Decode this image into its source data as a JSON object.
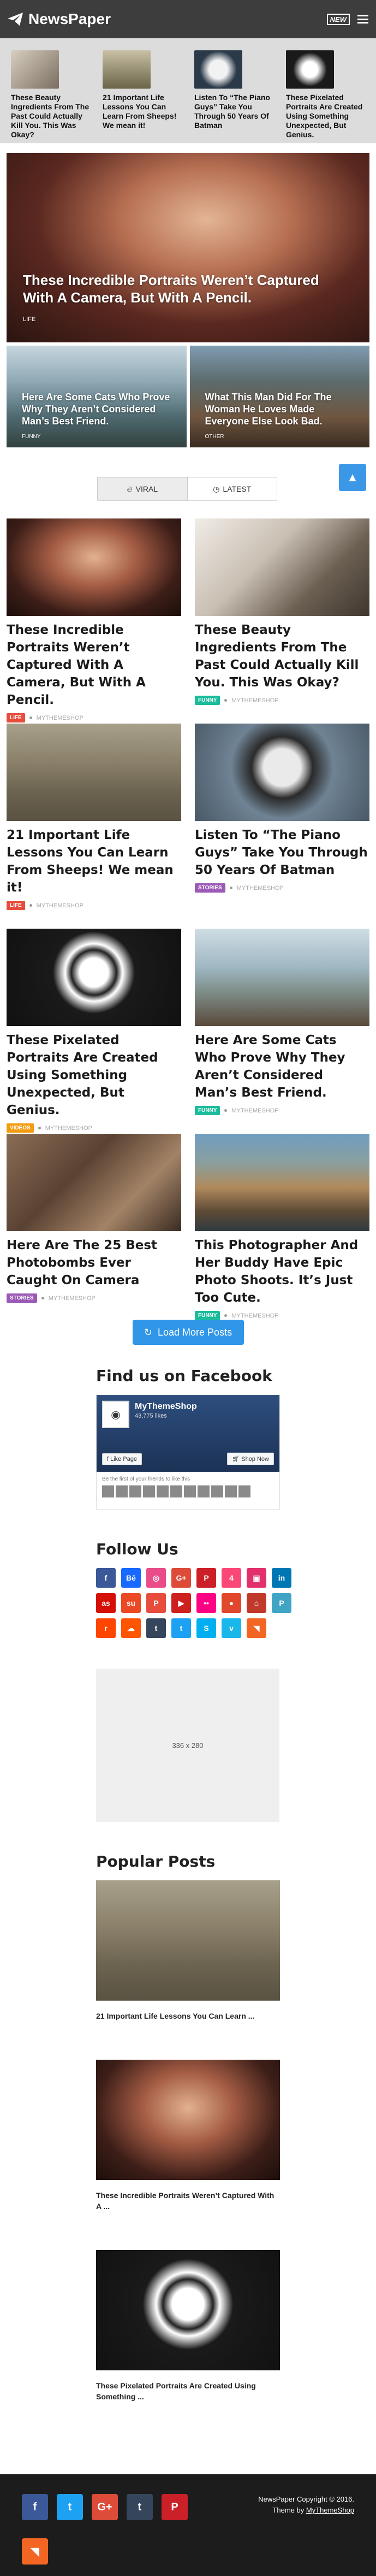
{
  "header": {
    "logo_text": "NewsPaper",
    "new_badge": "NEW"
  },
  "ticker": [
    {
      "title": "These Beauty Ingredients From The Past Could Actually Kill You. This Was Okay?",
      "thumb": "#8a7f74"
    },
    {
      "title": "21 Important Life Lessons You Can Learn From Sheeps! We mean it!",
      "thumb": "#9b9074"
    },
    {
      "title": "Listen To “The Piano Guys” Take You Through 50 Years Of Batman",
      "thumb": "#3a4a5a"
    },
    {
      "title": "These Pixelated Portraits Are Created Using Something Unexpected, But Genius.",
      "thumb": "#1f2d3a"
    }
  ],
  "featured": {
    "main": {
      "title": "These Incredible Portraits Weren’t Captured With A Camera, But With A Pencil.",
      "category": "LIFE"
    },
    "left": {
      "title": "Here Are Some Cats Who Prove Why They Aren’t Considered Man’s Best Friend.",
      "category": "FUNNY"
    },
    "right": {
      "title": "What This Man Did For The Woman He Loves Made Everyone Else Look Bad.",
      "category": "OTHER"
    }
  },
  "tabs": {
    "viral": "VIRAL",
    "latest": "LATEST"
  },
  "posts": [
    {
      "title": "These Incredible Portraits Weren’t Captured With A Camera, But With A Pencil.",
      "category": "LIFE",
      "cat_color": "#e74c3c",
      "author": "MYTHEMESHOP"
    },
    {
      "title": "These Beauty Ingredients From The Past Could Actually Kill You. This Was Okay?",
      "category": "FUNNY",
      "cat_color": "#1abc9c",
      "author": "MYTHEMESHOP"
    },
    {
      "title": "21 Important Life Lessons You Can Learn From Sheeps! We mean it!",
      "category": "LIFE",
      "cat_color": "#e74c3c",
      "author": "MYTHEMESHOP"
    },
    {
      "title": "Listen To “The Piano Guys” Take You Through 50 Years Of Batman",
      "category": "STORIES",
      "cat_color": "#9b59b6",
      "author": "MYTHEMESHOP"
    },
    {
      "title": "These Pixelated Portraits Are Created Using Something Unexpected, But Genius.",
      "category": "VIDEOS",
      "cat_color": "#f39c12",
      "author": "MYTHEMESHOP"
    },
    {
      "title": "Here Are Some Cats Who Prove Why They Aren’t Considered Man’s Best Friend.",
      "category": "FUNNY",
      "cat_color": "#1abc9c",
      "author": "MYTHEMESHOP"
    },
    {
      "title": "Here Are The 25 Best Photobombs Ever Caught On Camera",
      "category": "STORIES",
      "cat_color": "#9b59b6",
      "author": "MYTHEMESHOP"
    },
    {
      "title": "This Photographer And Her Buddy Have Epic Photo Shoots. It’s Just Too Cute.",
      "category": "FUNNY",
      "cat_color": "#1abc9c",
      "author": "MYTHEMESHOP"
    }
  ],
  "load_more": "Load More Posts",
  "facebook": {
    "heading": "Find us on Facebook",
    "page_name": "MyThemeShop",
    "likes": "43,775 likes",
    "like_btn": "Like Page",
    "shop_btn": "Shop Now",
    "friends_text": "Be the first of your friends to like this"
  },
  "follow": {
    "heading": "Follow Us"
  },
  "ad": {
    "label": "336 x 280"
  },
  "popular": {
    "heading": "Popular Posts",
    "items": [
      {
        "title": "21 Important Life Lessons You Can Learn ..."
      },
      {
        "title": "These Incredible Portraits Weren’t Captured With A ..."
      },
      {
        "title": "These Pixelated Portraits Are Created Using Something ..."
      }
    ]
  },
  "footer": {
    "copy1": "NewsPaper Copyright © 2016.",
    "copy2": "Theme by ",
    "copy_link": "MyThemeShop"
  }
}
